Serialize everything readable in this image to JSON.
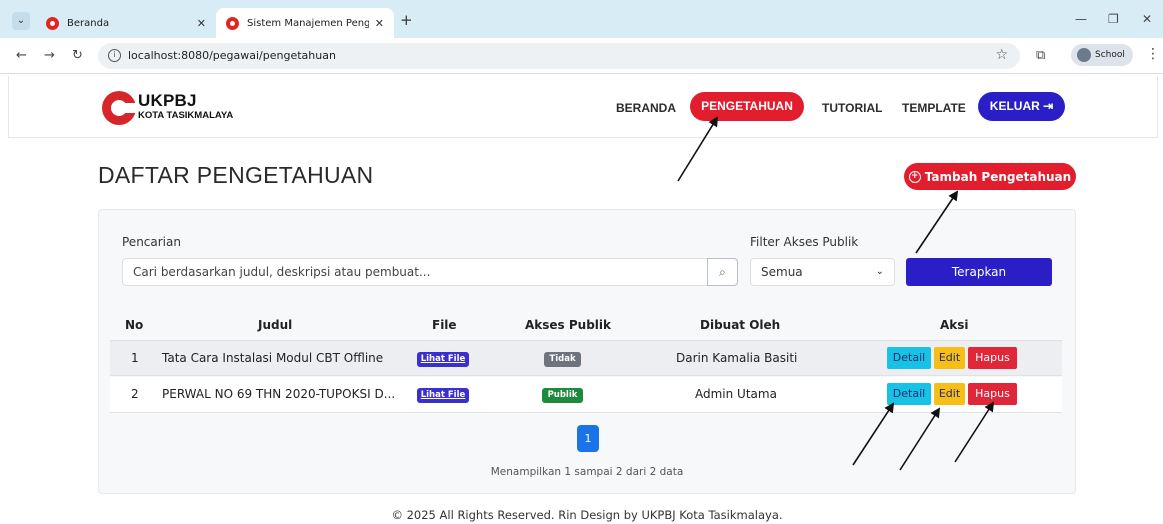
{
  "browser": {
    "tabs": [
      {
        "title": "Beranda"
      },
      {
        "title": "Sistem Manajemen Pengetahuan"
      }
    ],
    "new_tab_label": "+",
    "url": "localhost:8080/pegawai/pengetahuan",
    "profile_label": "School"
  },
  "header": {
    "logo_title": "UKPBJ",
    "logo_subtitle": "KOTA TASIKMALAYA",
    "nav": {
      "home": "BERANDA",
      "knowledge": "PENGETAHUAN",
      "tutorial": "TUTORIAL",
      "template": "TEMPLATE",
      "logout": "KELUAR"
    }
  },
  "page": {
    "title": "DAFTAR PENGETAHUAN",
    "add_button": "Tambah Pengetahuan",
    "search_label": "Pencarian",
    "search_placeholder": "Cari berdasarkan judul, deskripsi atau pembuat...",
    "filter_label": "Filter Akses Publik",
    "filter_value": "Semua",
    "apply_button": "Terapkan"
  },
  "table": {
    "headers": {
      "no": "No",
      "judul": "Judul",
      "file": "File",
      "akses": "Akses Publik",
      "dibuat": "Dibuat Oleh",
      "aksi": "Aksi"
    },
    "rows": [
      {
        "no": "1",
        "judul": "Tata Cara Instalasi Modul CBT Offline",
        "file": "Lihat File",
        "akses": "Tidak",
        "dibuat": "Darin Kamalia Basiti",
        "detail": "Detail",
        "edit": "Edit",
        "hapus": "Hapus"
      },
      {
        "no": "2",
        "judul": "PERWAL NO 69 THN 2020-TUPOKSI D...",
        "file": "Lihat File",
        "akses": "Publik",
        "dibuat": "Admin Utama",
        "detail": "Detail",
        "edit": "Edit",
        "hapus": "Hapus"
      }
    ],
    "current_page": "1",
    "info": "Menampilkan 1 sampai 2 dari 2 data"
  },
  "footer": "© 2025 All Rights Reserved. Rin Design by UKPBJ Kota Tasikmalaya.",
  "colors": {
    "brand_red": "#e11d2e",
    "brand_blue": "#2a1fc7",
    "badge_gray": "#6c757d",
    "badge_green": "#1e8a3e",
    "detail": "#18c2e6",
    "edit": "#f7be16",
    "hapus": "#e02639"
  }
}
